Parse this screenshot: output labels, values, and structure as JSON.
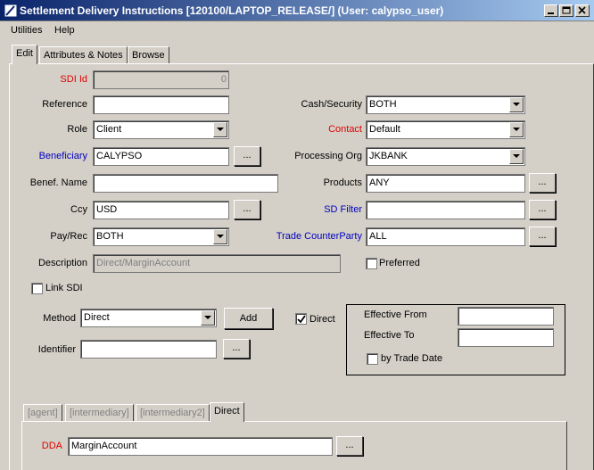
{
  "window": {
    "title": "Settlement Delivery Instructions  [120100/LAPTOP_RELEASE/] (User: calypso_user)",
    "icon": "app-icon",
    "controls": [
      "minimize-icon",
      "maximize-icon",
      "close-icon"
    ]
  },
  "menu": {
    "utilities": "Utilities",
    "help": "Help"
  },
  "tabs": {
    "edit": "Edit",
    "attributes": "Attributes & Notes",
    "browse": "Browse"
  },
  "form": {
    "sdi_id": {
      "label": "SDI Id",
      "value": "0"
    },
    "reference": {
      "label": "Reference",
      "value": ""
    },
    "role": {
      "label": "Role",
      "value": "Client"
    },
    "beneficiary": {
      "label": "Beneficiary",
      "value": "CALYPSO",
      "button": "..."
    },
    "benef_name": {
      "label": "Benef. Name",
      "value": ""
    },
    "ccy": {
      "label": "Ccy",
      "value": "USD",
      "button": "..."
    },
    "pay_rec": {
      "label": "Pay/Rec",
      "value": "BOTH"
    },
    "description": {
      "label": "Description",
      "value": "Direct/MarginAccount"
    },
    "cash_security": {
      "label": "Cash/Security",
      "value": "BOTH"
    },
    "contact": {
      "label": "Contact",
      "value": "Default"
    },
    "processing_org": {
      "label": "Processing Org",
      "value": "JKBANK"
    },
    "products": {
      "label": "Products",
      "value": "ANY",
      "button": "..."
    },
    "sd_filter": {
      "label": "SD Filter",
      "value": "",
      "button": "..."
    },
    "trade_counterparty": {
      "label": "Trade CounterParty",
      "value": "ALL",
      "button": "..."
    },
    "preferred": {
      "label": "Preferred",
      "checked": false
    },
    "link_sdi": {
      "label": "Link SDI",
      "checked": false
    },
    "method": {
      "label": "Method",
      "value": "Direct",
      "add_button": "Add"
    },
    "direct": {
      "label": "Direct",
      "checked": true
    },
    "identifier": {
      "label": "Identifier",
      "value": "",
      "button": "..."
    },
    "effective_from": {
      "label": "Effective From",
      "value": ""
    },
    "effective_to": {
      "label": "Effective To",
      "value": ""
    },
    "by_trade_date": {
      "label": "by Trade Date",
      "checked": false
    }
  },
  "subtabs": {
    "agent": "[agent]",
    "intermediary": "[intermediary]",
    "intermediary2": "[intermediary2]",
    "direct": "Direct"
  },
  "dda": {
    "label": "DDA",
    "value": "MarginAccount",
    "button": "..."
  },
  "colors": {
    "title_start": "#0a246a",
    "title_end": "#a6caf0",
    "required": "#e00000",
    "link": "#0000c0",
    "face": "#d4d0c8"
  }
}
